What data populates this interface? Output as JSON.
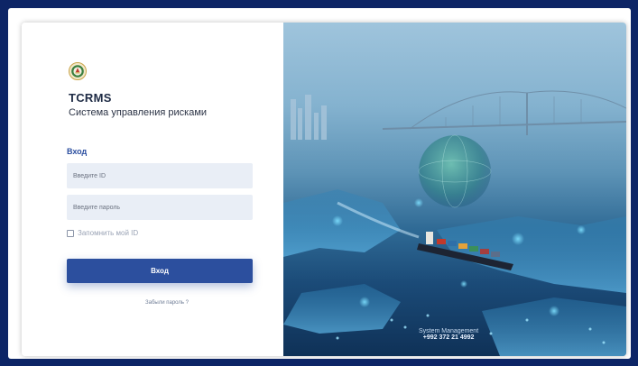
{
  "app": {
    "name": "TCRMS",
    "subtitle": "Система управления рисками"
  },
  "login": {
    "section_title": "Вход",
    "id_placeholder": "Введите ID",
    "password_placeholder": "Введите пароль",
    "remember_label": "Запомнить мой ID",
    "remember_checked": false,
    "submit_label": "Вход",
    "forgot_link": "Забыли пароль ?"
  },
  "hero": {
    "footer_line1": "System Management",
    "footer_line2": "+992 372 21 4992"
  },
  "colors": {
    "outer_background": "#0d2566",
    "primary": "#2c4f9e",
    "field_background": "#e9eef6"
  },
  "icons": {
    "logo": "emblem-logo-icon",
    "checkbox": "checkbox-icon"
  }
}
